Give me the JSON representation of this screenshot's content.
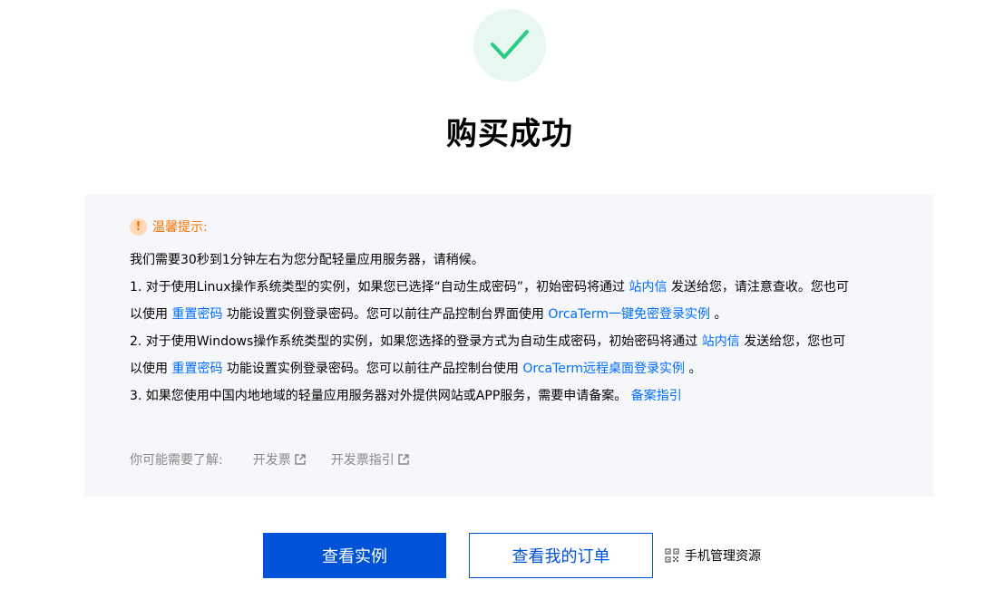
{
  "page": {
    "title": "购买成功"
  },
  "notice": {
    "title": "温馨提示:",
    "intro": "我们需要30秒到1分钟左右为您分配轻量应用服务器，请稍候。",
    "item1": {
      "part1": "1. 对于使用Linux操作系统类型的实例，如果您已选择“自动生成密码”，初始密码将通过 ",
      "link1": "站内信",
      "part2": " 发送给您，请注意查收。您也可",
      "part3": "以使用 ",
      "link2": "重置密码",
      "part4": " 功能设置实例登录密码。您可以前往产品控制台界面使用 ",
      "link3": "OrcaTerm一键免密登录实例",
      "part5": " 。"
    },
    "item2": {
      "part1": "2. 对于使用Windows操作系统类型的实例，如果您选择的登录方式为自动生成密码，初始密码将通过 ",
      "link1": "站内信",
      "part2": " 发送给您，您也可",
      "part3": "以使用 ",
      "link2": "重置密码",
      "part4": " 功能设置实例登录密码。您可以前往产品控制台使用 ",
      "link3": "OrcaTerm远程桌面登录实例",
      "part5": " 。"
    },
    "item3": {
      "part1": "3. 如果您使用中国内地地域的轻量应用服务器对外提供网站或APP服务，需要申请备案。 ",
      "link1": "备案指引"
    },
    "also": {
      "label": "你可能需要了解:",
      "links": [
        "开发票",
        "开发票指引"
      ]
    }
  },
  "actions": {
    "view_instance": "查看实例",
    "view_orders": "查看我的订单",
    "mobile_manage": "手机管理资源"
  },
  "colors": {
    "primary": "#0052d9",
    "link": "#006eff",
    "success": "#29cc85",
    "warning": "#ff7200"
  }
}
